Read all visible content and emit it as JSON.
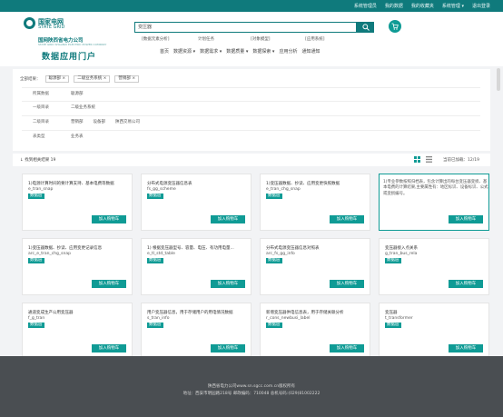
{
  "topbar": {
    "links": [
      "系统管理员",
      "我的数据",
      "我的收藏夹",
      "系统管理 ▾",
      "退出登录"
    ]
  },
  "brand": {
    "name_cn": "国家电网",
    "name_en": "STATE GRID",
    "company": "国网陕西省电力公司",
    "company_en": "STATE GRID SHAANXI ELECTRIC POWER COMPANY",
    "portal": "数据应用门户"
  },
  "search": {
    "value": "变压器"
  },
  "hot": [
    "[数据元素分析]",
    "计划任务",
    "[对象模型]",
    "[应用系统]"
  ],
  "nav": [
    "首页",
    "数据资源 ▾",
    "数据需求 ▾",
    "数据质量 ▾",
    "数据探索 ▾",
    "应用分析",
    "通知通知"
  ],
  "filter": {
    "selected_label": "全部结果：",
    "selected": [
      "聪源部 ×",
      "二级业务系统 ×",
      "营销部 ×"
    ],
    "rows": [
      {
        "label": "所属数据",
        "options": [
          "聪源部"
        ]
      },
      {
        "label": "一级目录",
        "options": [
          "二级业务系统"
        ]
      },
      {
        "label": "二级目录",
        "options": [
          "营销部",
          "设备部",
          "陕西交易公司"
        ]
      },
      {
        "label": "表类型",
        "options": [
          "业务表"
        ]
      }
    ]
  },
  "results": {
    "count_text": "↓ 找到相关结果 19",
    "page_text": "当前已加载：12/19"
  },
  "cards": [
    {
      "title": "1)电源计算时间的要计算支持、基本电费等数据",
      "code": "e_tran_snap",
      "tag": "数据层",
      "button": "加入购物车"
    },
    {
      "title": "分布式电源变压器信息表",
      "code": "fs_gg_scheme",
      "tag": "数据层",
      "button": "加入购物车"
    },
    {
      "title": "1)变压器数据、抄读、应用变更快照数据",
      "code": "e_tran_chg_snap",
      "tag": "数据层",
      "button": "加入购物车"
    },
    {
      "desc": "1)专业参数按照归档表，包含计算出的每台变压器变损、基本电费的计算结果,主要属性有：地区标识、设备标识、公式或变损编号。",
      "button": "加入购物车"
    },
    {
      "title": "1)变压器数据、抄读、应用变更记录信息",
      "code": "arc_e_tran_chg_snap",
      "tag": "数据层",
      "button": "加入购物车"
    },
    {
      "title": "1) 根据变压器型号、容量、电压、有功用电量...",
      "code": "e_tl_std_table",
      "tag": "数据层",
      "button": "加入购物车"
    },
    {
      "title": "分布式电源变压器信息对照表",
      "code": "arc_fs_gg_info",
      "tag": "数据层",
      "button": "加入购物车"
    },
    {
      "title": "变压器接入点关系",
      "code": "g_tran_bus_rela",
      "tag": "数据层",
      "button": "加入购物车"
    },
    {
      "title": "通道变成生产公用变压器",
      "code": "f_g_tran",
      "tag": "数据层",
      "button": "加入购物车"
    },
    {
      "title": "用户变压器信息，用于存储用户的用电情况数据",
      "code": "s_tran_info",
      "tag": "数据层",
      "button": "加入购物车"
    },
    {
      "title": "新增变压器供电信息表，用于存储关联分析",
      "code": "r_cons_newbusi_label",
      "tag": "数据层",
      "button": "加入购物车"
    },
    {
      "title": "变压器",
      "code": "t_transformer",
      "tag": "数据层",
      "button": "加入购物车"
    }
  ],
  "footer": {
    "line1": "陕西省电力公司www.sn.sgcc.com.cn版权所有",
    "line2": "地址：西安市明园路218号    邮政编码：710048    总机号码:(029)81002222"
  },
  "colors": {
    "accent": "#0f9b95",
    "topbar": "#0f7a7c",
    "footer": "#4a4e52"
  }
}
